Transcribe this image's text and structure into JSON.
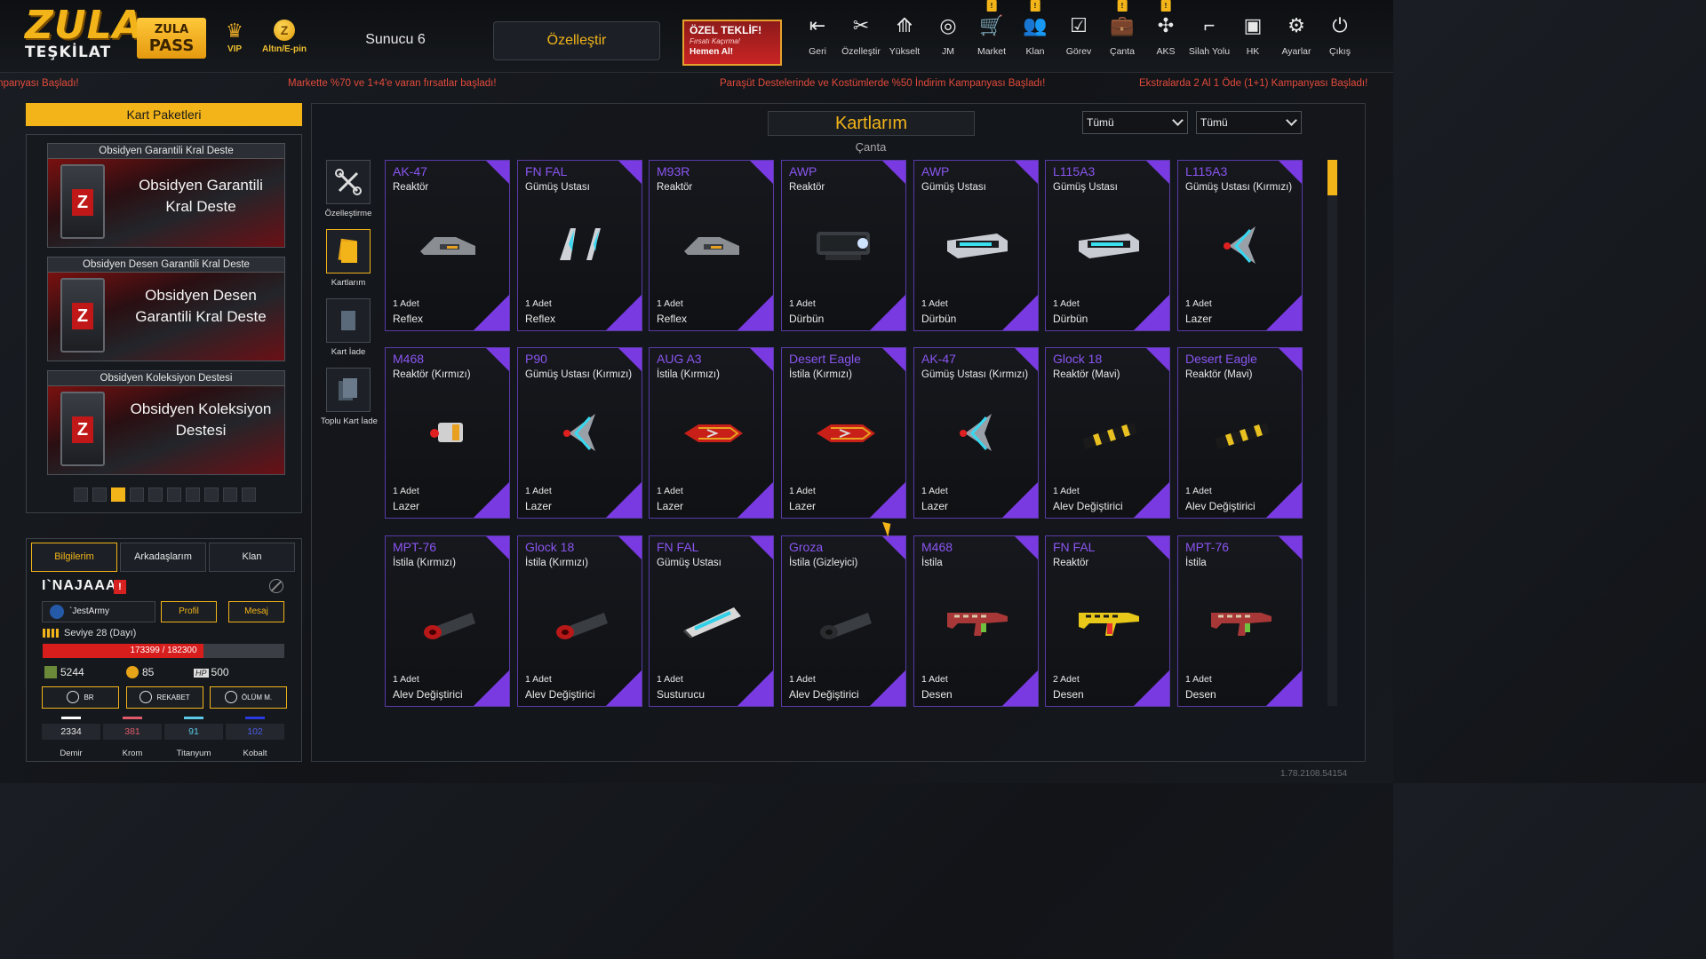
{
  "header": {
    "logo_main": "ZULA",
    "logo_sub": "TEŞKİLAT",
    "pass_line1": "ZULA",
    "pass_line2": "PASS",
    "vip_label": "VIP",
    "gold_label": "Altın/E-pin",
    "server": "Sunucu 6",
    "customize_label": "Özelleştir",
    "offer_title": "ÖZEL TEKLİF!",
    "offer_sub": "Fırsatı Kaçırma!",
    "offer_cta": "Hemen Al!",
    "nav": [
      {
        "label": "Geri",
        "icon": "back-icon"
      },
      {
        "label": "Özelleştir",
        "icon": "tools-icon"
      },
      {
        "label": "Yükselt",
        "icon": "upgrade-icon"
      },
      {
        "label": "JM",
        "icon": "coins-icon"
      },
      {
        "label": "Market",
        "icon": "cart-icon",
        "badge": "!"
      },
      {
        "label": "Klan",
        "icon": "clan-icon",
        "badge": "!"
      },
      {
        "label": "Görev",
        "icon": "tasks-icon"
      },
      {
        "label": "Çanta",
        "icon": "bag-icon",
        "badge": "!"
      },
      {
        "label": "AKS",
        "icon": "accessory-icon",
        "badge": "!"
      },
      {
        "label": "Silah Yolu",
        "icon": "gun-icon"
      },
      {
        "label": "HK",
        "icon": "window-icon"
      },
      {
        "label": "Ayarlar",
        "icon": "settings-icon"
      },
      {
        "label": "Çıkış",
        "icon": "power-icon"
      }
    ]
  },
  "ticker": [
    "mpanyası Başladı!",
    "Markette %70 ve 1+4'e varan fırsatlar başladı!",
    "Paraşüt Destelerinde ve Kostümlerde %50 İndirim Kampanyası Başladı!",
    "Ekstralarda 2 Al 1 Öde (1+1) Kampanyası Başladı!"
  ],
  "card_packs": {
    "title": "Kart Paketleri",
    "decks": [
      {
        "header": "Obsidyen Garantili Kral Deste",
        "line1": "Obsidyen Garantili",
        "line2": "Kral Deste"
      },
      {
        "header": "Obsidyen Desen Garantili Kral Deste",
        "line1": "Obsidyen Desen",
        "line2": "Garantili Kral Deste"
      },
      {
        "header": "Obsidyen Koleksiyon Destesi",
        "line1": "Obsidyen Koleksiyon",
        "line2": "Destesi"
      }
    ],
    "page_count": 10,
    "active_page": 3
  },
  "profile": {
    "tabs": [
      "Bilgilerim",
      "Arkadaşlarım",
      "Klan"
    ],
    "active_tab": "Bilgilerim",
    "name": "I`NAJAAA",
    "warning": "!",
    "clan": "`JestArmy",
    "profile_btn": "Profil",
    "message_btn": "Mesaj",
    "level": "Seviye 28 (Dayı)",
    "xp_text": "173399 / 182300",
    "xp_fraction": 0.951,
    "zp": "5244",
    "gold": "85",
    "hp": "500",
    "hp_label": "HP",
    "ranks": [
      "BR",
      "REKABET",
      "ÖLÜM M."
    ],
    "materials": [
      {
        "name": "Demir",
        "value": "2334",
        "color": "#ffffff"
      },
      {
        "name": "Krom",
        "value": "381",
        "color": "#e05a6a"
      },
      {
        "name": "Titanyum",
        "value": "91",
        "color": "#5ac8e6"
      },
      {
        "name": "Kobalt",
        "value": "102",
        "color": "#2a3ae0"
      }
    ]
  },
  "main": {
    "title": "Kartlarım",
    "subtitle": "Çanta",
    "filter1": "Tümü",
    "filter2": "Tümü",
    "side_tools": [
      "Özelleştirme",
      "Kartlarım",
      "Kart İade",
      "Toplu Kart İade"
    ],
    "cards": [
      {
        "weapon": "AK-47",
        "type": "Reaktör",
        "qty": "1 Adet",
        "attachment": "Reflex",
        "art": "reflex-gray"
      },
      {
        "weapon": "FN FAL",
        "type": "Gümüş Ustası",
        "qty": "1 Adet",
        "attachment": "Reflex",
        "art": "reflex-twin"
      },
      {
        "weapon": "M93R",
        "type": "Reaktör",
        "qty": "1 Adet",
        "attachment": "Reflex",
        "art": "reflex-gray"
      },
      {
        "weapon": "AWP",
        "type": "Reaktör",
        "qty": "1 Adet",
        "attachment": "Dürbün",
        "art": "scope-dark"
      },
      {
        "weapon": "AWP",
        "type": "Gümüş Ustası",
        "qty": "1 Adet",
        "attachment": "Dürbün",
        "art": "scope-cyan"
      },
      {
        "weapon": "L115A3",
        "type": "Gümüş Ustası",
        "qty": "1 Adet",
        "attachment": "Dürbün",
        "art": "scope-cyan"
      },
      {
        "weapon": "L115A3",
        "type": "Gümüş Ustası (Kırmızı)",
        "qty": "1 Adet",
        "attachment": "Lazer",
        "art": "laser-cyan"
      },
      {
        "weapon": "M468",
        "type": "Reaktör (Kırmızı)",
        "qty": "1 Adet",
        "attachment": "Lazer",
        "art": "laser-box"
      },
      {
        "weapon": "P90",
        "type": "Gümüş Ustası (Kırmızı)",
        "qty": "1 Adet",
        "attachment": "Lazer",
        "art": "laser-cyan"
      },
      {
        "weapon": "AUG A3",
        "type": "İstila (Kırmızı)",
        "qty": "1 Adet",
        "attachment": "Lazer",
        "art": "laser-red"
      },
      {
        "weapon": "Desert Eagle",
        "type": "İstila (Kırmızı)",
        "qty": "1 Adet",
        "attachment": "Lazer",
        "art": "laser-red"
      },
      {
        "weapon": "AK-47",
        "type": "Gümüş Ustası (Kırmızı)",
        "qty": "1 Adet",
        "attachment": "Lazer",
        "art": "laser-cyan"
      },
      {
        "weapon": "Glock 18",
        "type": "Reaktör (Mavi)",
        "qty": "1 Adet",
        "attachment": "Alev Değiştirici",
        "art": "flash-yellow"
      },
      {
        "weapon": "Desert Eagle",
        "type": "Reaktör (Mavi)",
        "qty": "1 Adet",
        "attachment": "Alev Değiştirici",
        "art": "flash-yellow"
      },
      {
        "weapon": "MPT-76",
        "type": "İstila (Kırmızı)",
        "qty": "1 Adet",
        "attachment": "Alev Değiştirici",
        "art": "flash-red"
      },
      {
        "weapon": "Glock 18",
        "type": "İstila (Kırmızı)",
        "qty": "1 Adet",
        "attachment": "Alev Değiştirici",
        "art": "flash-red"
      },
      {
        "weapon": "FN FAL",
        "type": "Gümüş Ustası",
        "qty": "1 Adet",
        "attachment": "Susturucu",
        "art": "silencer-cyan"
      },
      {
        "weapon": "Groza",
        "type": "İstila (Gizleyici)",
        "qty": "1 Adet",
        "attachment": "Alev Değiştirici",
        "art": "flash-dark"
      },
      {
        "weapon": "M468",
        "type": "İstila",
        "qty": "1 Adet",
        "attachment": "Desen",
        "art": "rifle-red"
      },
      {
        "weapon": "FN FAL",
        "type": "Reaktör",
        "qty": "2 Adet",
        "attachment": "Desen",
        "art": "rifle-yellow"
      },
      {
        "weapon": "MPT-76",
        "type": "İstila",
        "qty": "1 Adet",
        "attachment": "Desen",
        "art": "rifle-red"
      }
    ]
  },
  "version": "1.78.2108.54154",
  "colors": {
    "accent": "#f2b419",
    "card_purple": "#7a3ae2",
    "ticker_red": "#e24a3b"
  }
}
